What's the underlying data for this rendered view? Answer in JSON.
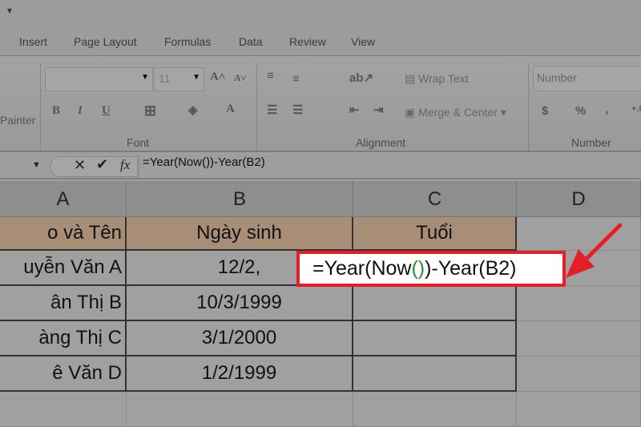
{
  "ribbon": {
    "tabs": [
      "Insert",
      "Page Layout",
      "Formulas",
      "Data",
      "Review",
      "View"
    ],
    "clipboard_partial": "Painter",
    "font_size": "11",
    "groups": {
      "font": "Font",
      "alignment": "Alignment",
      "number": "Number"
    },
    "wrap_text": "Wrap Text",
    "merge_center": "Merge & Center",
    "number_format": "Number"
  },
  "formula_bar": {
    "formula": "=Year(Now())-Year(B2)",
    "fx": "fx"
  },
  "columns": [
    "A",
    "B",
    "C",
    "D"
  ],
  "rows": [
    [
      "o và Tên",
      "Ngày sinh",
      "Tuổi"
    ],
    [
      "uyễn Văn A",
      "12/2,",
      ""
    ],
    [
      "ân Thị B",
      "10/3/1999",
      ""
    ],
    [
      "àng Thị C",
      "3/1/2000",
      ""
    ],
    [
      "ê Văn D",
      "1/2/1999",
      ""
    ]
  ],
  "callout": {
    "before": "=Year(Now",
    "parens": "()",
    "after": ")-Year(B2)",
    "border_color": "#e3202a",
    "arrow_color": "#e3202a"
  }
}
